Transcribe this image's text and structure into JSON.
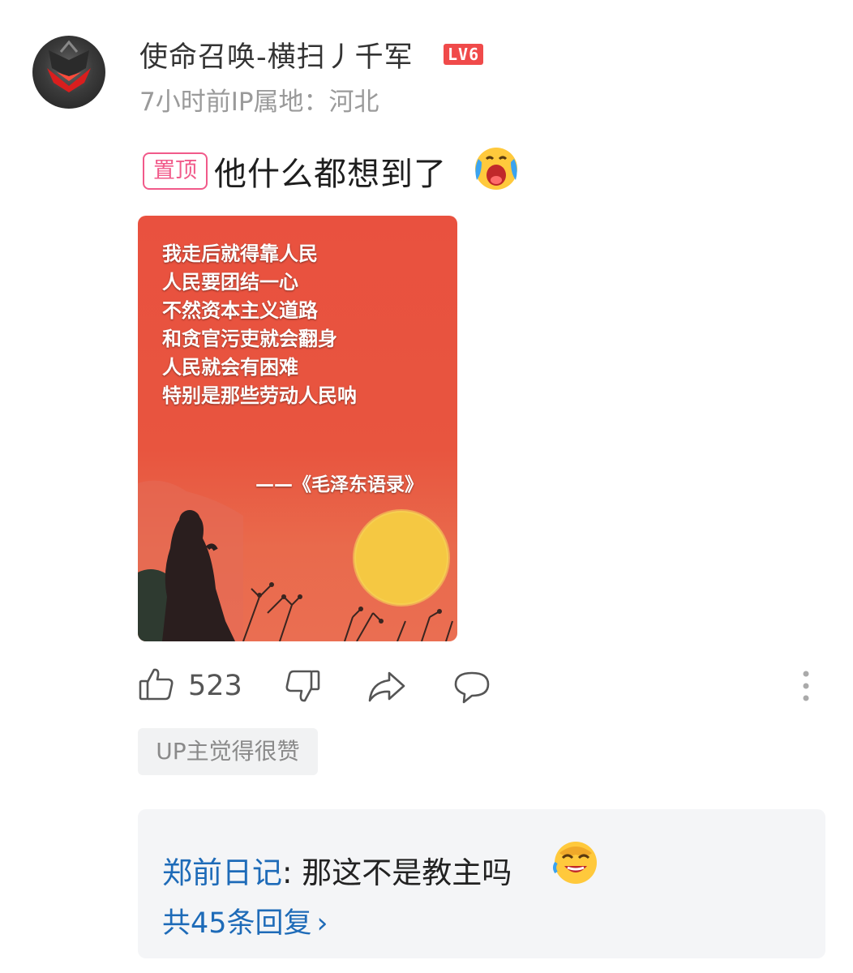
{
  "comment": {
    "author": "使命召唤-横扫丿千军",
    "level_badge": "LV6",
    "meta": "7小时前IP属地：河北",
    "pin_label": "置顶",
    "text": "他什么都想到了",
    "text_emoji": "crying-face-emoji",
    "image": {
      "lines": [
        "我走后就得靠人民",
        "人民要团结一心",
        "不然资本主义道路",
        "和贪官污吏就会翻身",
        "人民就会有困难",
        "特别是那些劳动人民呐"
      ],
      "source": "——《毛泽东语录》"
    },
    "actions": {
      "like_icon": "thumbs-up-icon",
      "like_count": "523",
      "dislike_icon": "thumbs-down-icon",
      "share_icon": "share-icon",
      "reply_icon": "reply-icon",
      "more_icon": "more-vertical-icon"
    },
    "up_liked_label": "UP主觉得很赞",
    "reply_preview": {
      "author": "郑前日记",
      "separator": ":",
      "text": " 那这不是教主吗",
      "emoji": "laughing-face-emoji",
      "count_label": "共45条回复",
      "chevron": "›"
    }
  },
  "colors": {
    "level_badge": "#f04a4a",
    "pin_badge": "#f15a8a",
    "link": "#1e6bb8",
    "image_bg": "#e9513f",
    "sun": "#f5c842"
  }
}
